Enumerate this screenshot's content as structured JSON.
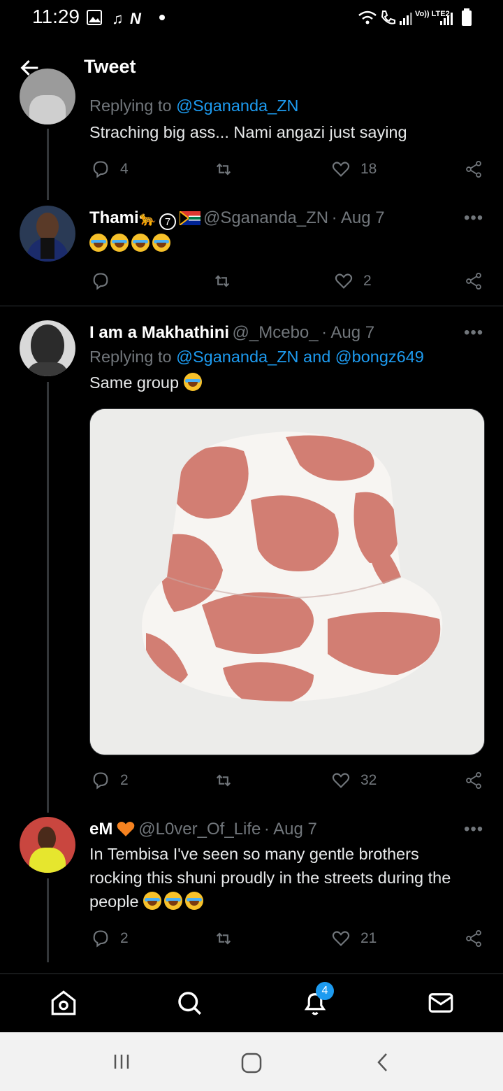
{
  "status": {
    "time": "11:29",
    "network": "Vo)) LTE2"
  },
  "topbar": {
    "title": "Tweet"
  },
  "tweets": [
    {
      "reply_prefix": "Replying to",
      "reply_to": "@Sgananda_ZN",
      "text": "Straching big ass... Nami angazi just saying",
      "replies": "4",
      "retweets": "",
      "likes": "18"
    },
    {
      "name": "Thami",
      "handle": "@Sgananda_ZN",
      "date": "· Aug 7",
      "replies": "",
      "retweets": "",
      "likes": "2"
    },
    {
      "name": "I am a Makhathini",
      "handle": "@_Mcebo_",
      "date": "· Aug 7",
      "reply_prefix": "Replying to",
      "reply_to": "@Sgananda_ZN and @bongz649",
      "text": "Same group",
      "replies": "2",
      "retweets": "",
      "likes": "32"
    },
    {
      "name": "eM",
      "handle": "@L0ver_Of_Life",
      "date": "· Aug 7",
      "text_line1": "In Tembisa I've seen so many gentle brothers",
      "text_line2": "rocking this shuni proudly in the streets during the",
      "text_line3": "people",
      "replies": "2",
      "retweets": "",
      "likes": "21"
    }
  ],
  "nav": {
    "notifications_badge": "4"
  },
  "colors": {
    "accent": "#1d9bf0",
    "background": "#000000",
    "muted": "#71767b"
  },
  "icons": [
    "back-arrow-icon",
    "reply-icon",
    "retweet-icon",
    "like-icon",
    "share-icon",
    "more-icon",
    "home-icon",
    "search-icon",
    "bell-icon",
    "mail-icon"
  ]
}
